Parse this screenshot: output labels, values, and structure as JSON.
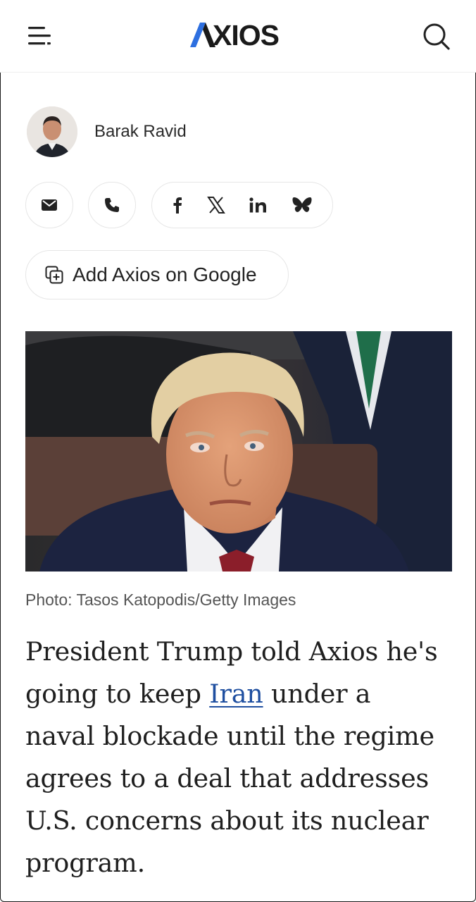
{
  "header": {
    "logo_text": "XIOS",
    "logo_aria": "AXIOS",
    "menu_icon": "hamburger-menu-icon",
    "search_icon": "search-icon"
  },
  "author": {
    "name": "Barak Ravid",
    "avatar_icon": "author-photo"
  },
  "contact": {
    "email_icon": "envelope-icon",
    "phone_icon": "phone-icon"
  },
  "share": {
    "items": [
      "facebook-icon",
      "x-icon",
      "linkedin-icon",
      "bluesky-icon"
    ]
  },
  "google_button": {
    "label": "Add Axios on Google",
    "icon": "add-source-icon"
  },
  "photo": {
    "credit": "Photo: Tasos Katopodis/Getty Images"
  },
  "article": {
    "lede_before": "President Trump told Axios he's going to keep ",
    "lede_link": "Iran",
    "lede_after": " under a naval blockade until the regime agrees to a deal that addresses U.S. concerns about its nuclear program."
  },
  "colors": {
    "logo_accent": "#2d6fe0",
    "link": "#1f4fa0",
    "border": "#e6e6e6"
  }
}
